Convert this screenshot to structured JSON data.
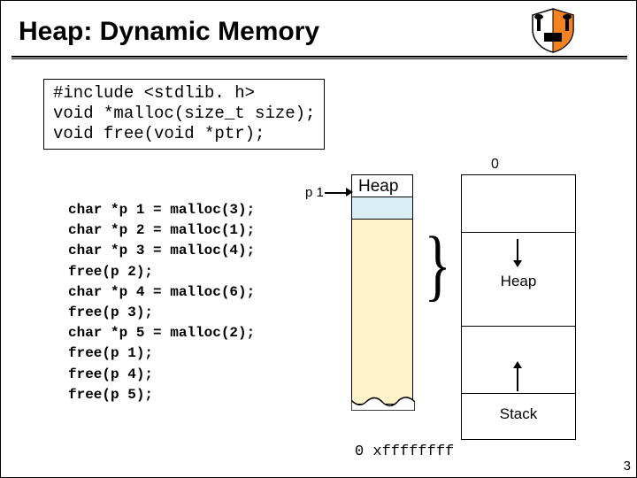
{
  "title": "Heap: Dynamic Memory",
  "prototypes": "#include <stdlib. h>\nvoid *malloc(size_t size);\nvoid free(void *ptr);",
  "code": "char *p 1 = malloc(3);\nchar *p 2 = malloc(1);\nchar *p 3 = malloc(4);\nfree(p 2);\nchar *p 4 = malloc(6);\nfree(p 3);\nchar *p 5 = malloc(2);\nfree(p 1);\nfree(p 4);\nfree(p 5);",
  "labels": {
    "zero": "0",
    "heap_top": "Heap",
    "p1": "p 1",
    "mem_heap": "Heap",
    "mem_stack": "Stack",
    "addr": "0 xffffffff"
  },
  "slide_number": "3"
}
